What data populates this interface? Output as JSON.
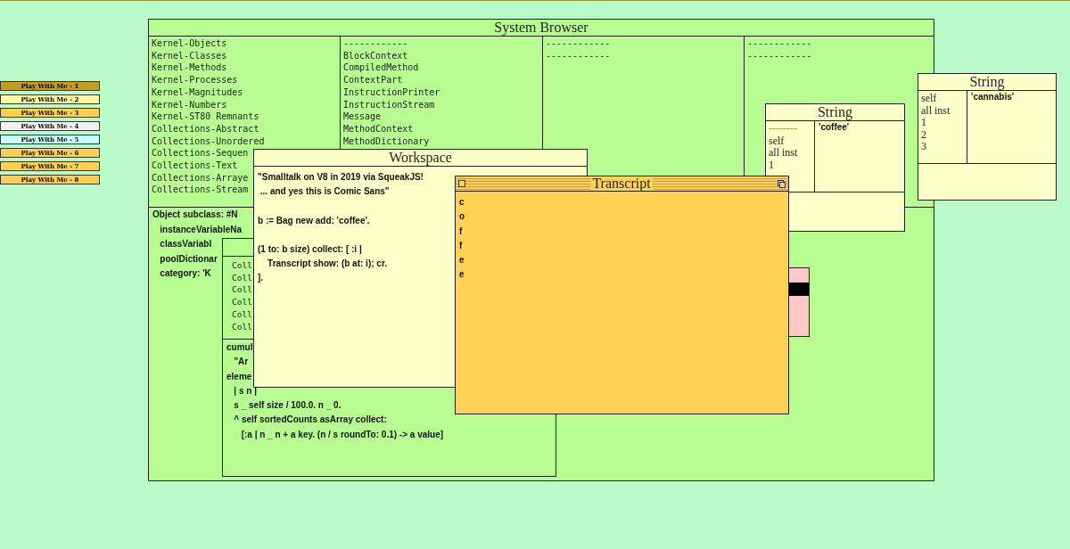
{
  "desktop_buttons": [
    {
      "label": "Play With Me - 1",
      "color": "#c89a20"
    },
    {
      "label": "Play With Me - 2",
      "color": "#ffff99"
    },
    {
      "label": "Play With Me - 3",
      "color": "#ffd050"
    },
    {
      "label": "Play With Me - 4",
      "color": "#f0f0f0"
    },
    {
      "label": "Play With Me - 5",
      "color": "#c8ffff"
    },
    {
      "label": "Play With Me - 6",
      "color": "#ffd050"
    },
    {
      "label": "Play With Me - 7",
      "color": "#ffd050"
    },
    {
      "label": "Play With Me - 8",
      "color": "#ffd050"
    }
  ],
  "system_browser": {
    "title": "System Browser",
    "categories": [
      "Kernel-Objects",
      "Kernel-Classes",
      "Kernel-Methods",
      "Kernel-Processes",
      "Kernel-Magnitudes",
      "Kernel-Numbers",
      "Kernel-ST80 Remnants",
      "Collections-Abstract",
      "Collections-Unordered",
      "Collections-Sequen",
      "Collections-Text",
      "Collections-Arraye",
      "Collections-Stream"
    ],
    "classes": [
      "------------",
      "BlockContext",
      "CompiledMethod",
      "ContextPart",
      "InstructionPrinter",
      "InstructionStream",
      "Message",
      "MethodContext",
      "MethodDictionary"
    ],
    "pane_3": [
      "------------",
      "------------"
    ],
    "pane_4": [
      "------------",
      "------------"
    ],
    "definition": [
      "Object subclass: #N",
      "   instanceVariableNa",
      "   classVariabl",
      "   poolDictionar",
      "   category: 'K"
    ]
  },
  "second_browser": {
    "list": [
      "Coll",
      "Coll",
      "Coll",
      "Coll",
      "Coll",
      "Coll"
    ],
    "code": [
      "cumul",
      "   \"Ar",
      "eleme",
      "   | s n |",
      "   s _ self size / 100.0. n _ 0.",
      "   ^ self sortedCounts asArray collect:",
      "      [:a | n _ n + a key. (n / s roundTo: 0.1) -> a value]"
    ]
  },
  "workspace": {
    "title": "Workspace",
    "paragraphs": [
      [
        "\"Smalltalk on V8 in 2019 via SqueakJS!",
        " ... and yes this is Comic Sans\""
      ],
      [
        "b := Bag new add: 'coffee'."
      ],
      [
        "(1 to: b size) collect: [ :i |",
        "    Transcript show: (b at: i); cr.",
        "]."
      ]
    ]
  },
  "inspectors": [
    {
      "title": "String",
      "fields": [
        "--------",
        "self",
        "all inst",
        "1"
      ],
      "value": "'coffee'"
    },
    {
      "title": "String",
      "fields": [
        "self",
        "all inst",
        "1",
        "2",
        "3"
      ],
      "value": "'cannabis'"
    }
  ],
  "transcript": {
    "title": "Transcript",
    "lines": [
      "c",
      "o",
      "f",
      "f",
      "e",
      "e"
    ]
  }
}
